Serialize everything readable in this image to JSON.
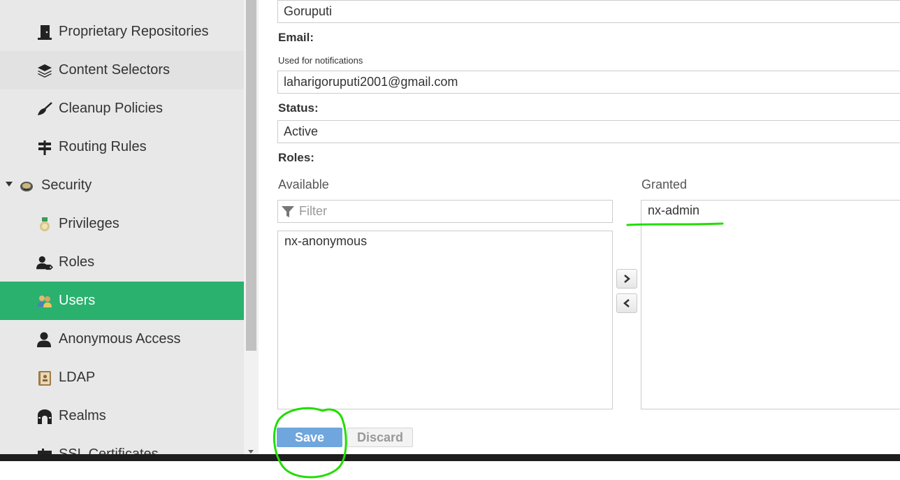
{
  "sidebar": {
    "items": [
      {
        "label": "Proprietary Repositories",
        "icon": "door-icon"
      },
      {
        "label": "Content Selectors",
        "icon": "layers-icon"
      },
      {
        "label": "Cleanup Policies",
        "icon": "broom-icon"
      },
      {
        "label": "Routing Rules",
        "icon": "signpost-icon"
      },
      {
        "label": "Security",
        "icon": "shield-badge-icon"
      },
      {
        "label": "Privileges",
        "icon": "medal-icon"
      },
      {
        "label": "Roles",
        "icon": "user-tag-icon"
      },
      {
        "label": "Users",
        "icon": "users-icon"
      },
      {
        "label": "Anonymous Access",
        "icon": "user-icon"
      },
      {
        "label": "LDAP",
        "icon": "address-book-icon"
      },
      {
        "label": "Realms",
        "icon": "castle-icon"
      },
      {
        "label": "SSL Certificates",
        "icon": "certificate-icon"
      }
    ],
    "selected": "Users",
    "colors": {
      "background": "#e8e8e8",
      "selected": "#2ab16e",
      "hover": "#e2e2e2"
    }
  },
  "form": {
    "last_name_value": "Goruputi",
    "email_label": "Email:",
    "email_hint": "Used for notifications",
    "email_value": "laharigoruputi2001@gmail.com",
    "status_label": "Status:",
    "status_value": "Active",
    "roles_label": "Roles:",
    "roles": {
      "available_title": "Available",
      "granted_title": "Granted",
      "filter_placeholder": "Filter",
      "available_items": [
        "nx-anonymous"
      ],
      "granted_items": [
        "nx-admin"
      ]
    }
  },
  "buttons": {
    "save_label": "Save",
    "discard_label": "Discard",
    "save_color": "#6fa6dd"
  },
  "annotations": {
    "color": "#22dd00"
  }
}
